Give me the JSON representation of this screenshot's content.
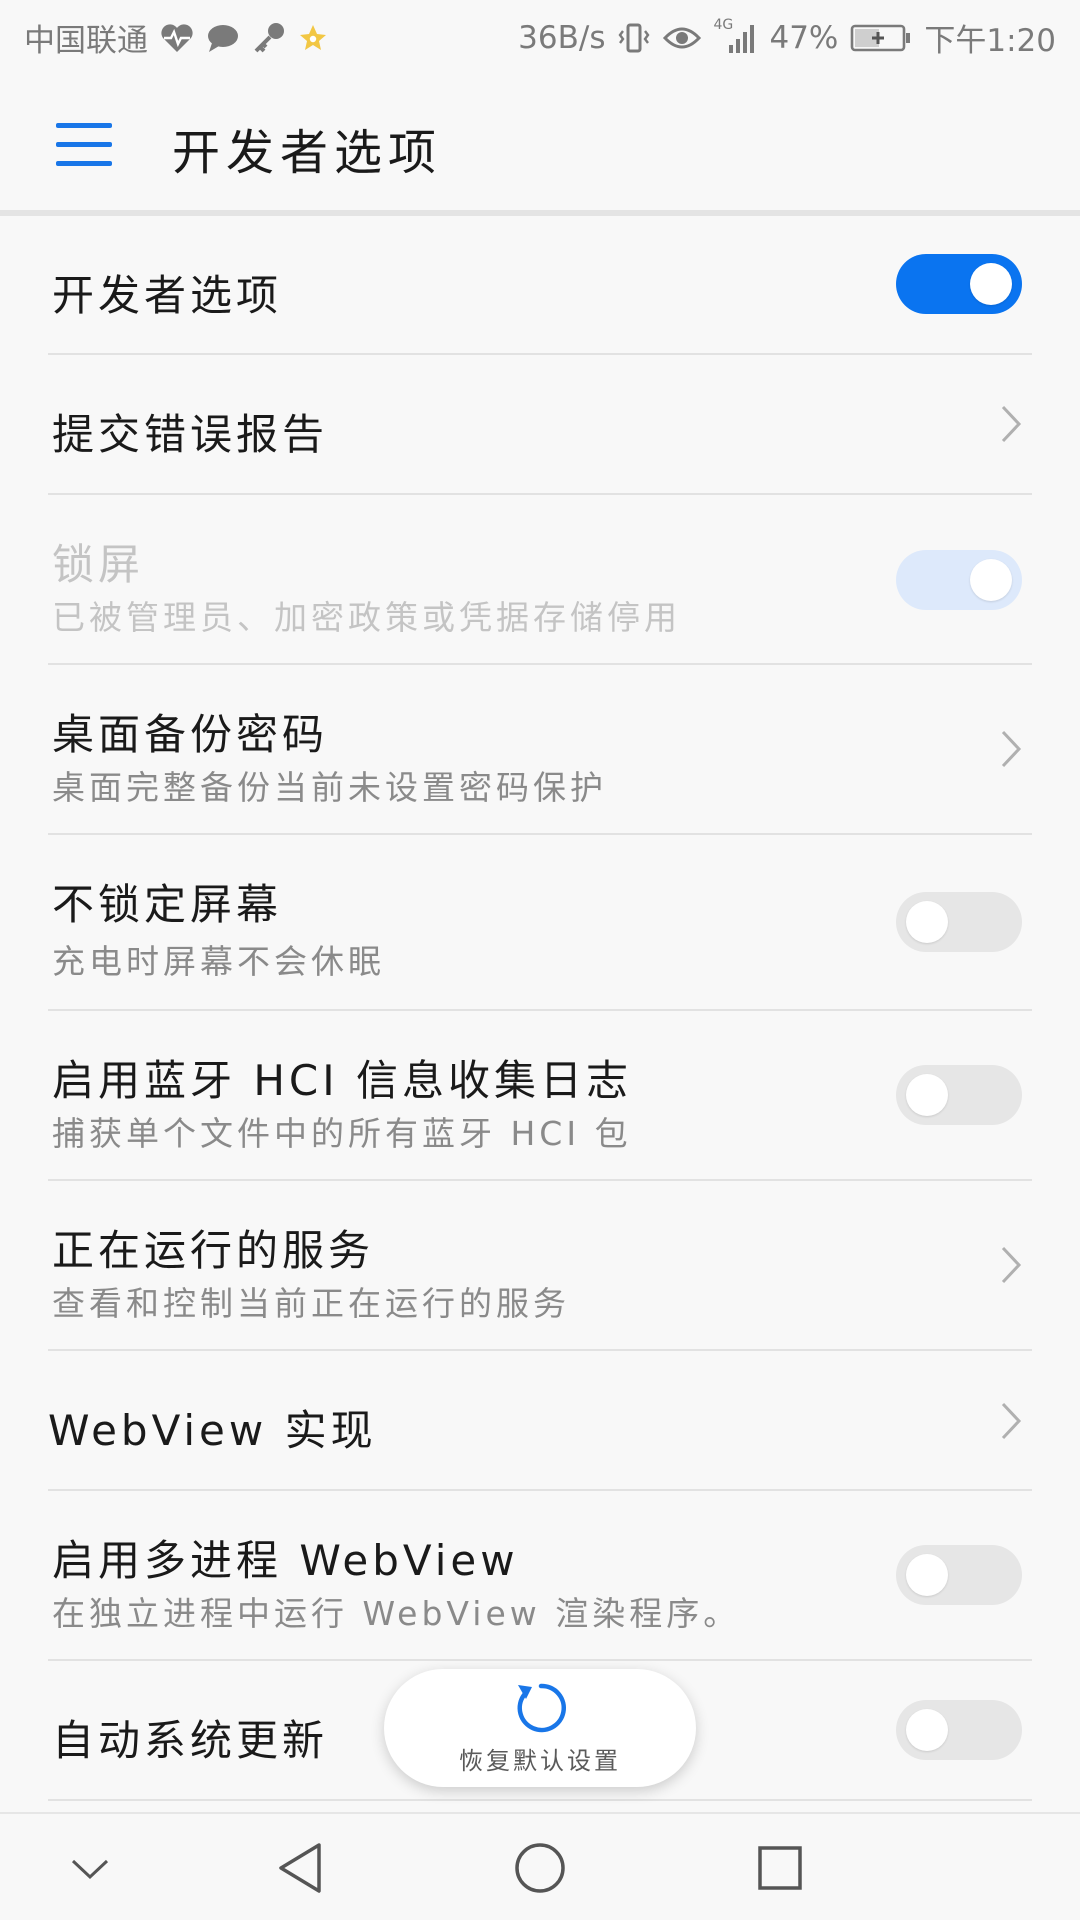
{
  "status_bar": {
    "carrier": "中国联通",
    "net_speed": "36B/s",
    "network_type": "4G",
    "battery_percent": "47%",
    "time": "下午1:20",
    "icons": [
      "heartbeat-icon",
      "chat-bubble-icon",
      "key-icon",
      "star-icon",
      "vibrate-icon",
      "eye-icon",
      "signal-icon",
      "battery-charging-icon"
    ]
  },
  "header": {
    "title": "开发者选项",
    "menu_icon": "hamburger-menu-icon"
  },
  "items": [
    {
      "title": "开发者选项",
      "control": "toggle",
      "state": "on"
    },
    {
      "title": "提交错误报告",
      "control": "chevron"
    },
    {
      "title": "锁屏",
      "subtitle": "已被管理员、加密政策或凭据存储停用",
      "control": "toggle",
      "state": "on",
      "disabled": true
    },
    {
      "title": "桌面备份密码",
      "subtitle": "桌面完整备份当前未设置密码保护",
      "control": "chevron"
    },
    {
      "title": "不锁定屏幕",
      "subtitle": "充电时屏幕不会休眠",
      "control": "toggle",
      "state": "off"
    },
    {
      "title": "启用蓝牙 HCI 信息收集日志",
      "subtitle": "捕获单个文件中的所有蓝牙 HCI 包",
      "control": "toggle",
      "state": "off"
    },
    {
      "title": "正在运行的服务",
      "subtitle": "查看和控制当前正在运行的服务",
      "control": "chevron"
    },
    {
      "title": "WebView 实现",
      "control": "chevron"
    },
    {
      "title": "启用多进程 WebView",
      "subtitle": "在独立进程中运行 WebView 渲染程序。",
      "control": "toggle",
      "state": "off"
    },
    {
      "title": "自动系统更新",
      "control": "toggle",
      "state": "off"
    }
  ],
  "reset_button": {
    "label": "恢复默认设置",
    "icon": "refresh-icon"
  },
  "colors": {
    "accent": "#0a74f0",
    "toggle_off": "#e6e6e6",
    "background": "#f8f8f8"
  },
  "nav_bar": {
    "buttons": [
      "collapse-icon",
      "back-icon",
      "home-icon",
      "recents-icon"
    ]
  }
}
